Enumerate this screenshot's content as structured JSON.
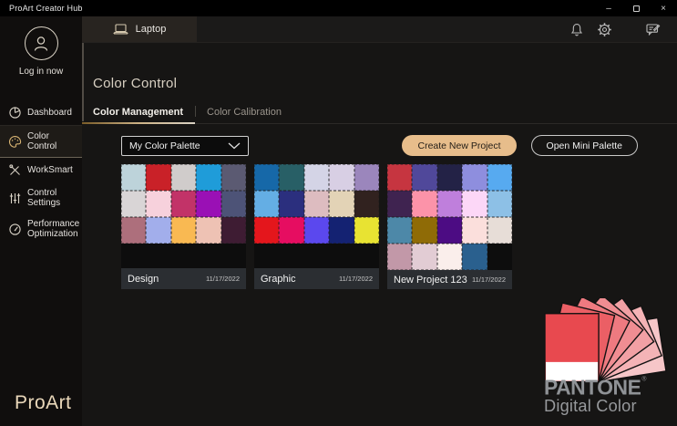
{
  "window": {
    "title": "ProArt Creator Hub",
    "minimize": "–",
    "close": "×"
  },
  "topbar": {
    "device_tab": "Laptop"
  },
  "sidebar": {
    "login_label": "Log in now",
    "items": [
      {
        "label": "Dashboard",
        "active": false
      },
      {
        "label": "Color Control",
        "active": true
      },
      {
        "label": "WorkSmart",
        "active": false
      },
      {
        "label": "Control Settings",
        "active": false
      },
      {
        "label": "Performance Optimization",
        "active": false
      }
    ]
  },
  "main": {
    "title": "Color Control",
    "tabs": [
      {
        "label": "Color Management",
        "active": true
      },
      {
        "label": "Color Calibration",
        "active": false
      }
    ],
    "palette_dropdown": {
      "value": "My Color Palette"
    },
    "buttons": {
      "create": "Create New Project",
      "mini": "Open Mini Palette"
    },
    "projects": [
      {
        "name": "Design",
        "date": "11/17/2022",
        "colors": [
          "#bdd3da",
          "#c92128",
          "#d0cccb",
          "#1f9cd9",
          "#5b5a72",
          "#d9d5d6",
          "#f7d1dc",
          "#c23368",
          "#9a10b5",
          "#4d5377",
          "#ad6f7c",
          "#a2aeeb",
          "#f9b952",
          "#eec2b4",
          "#3e1c33"
        ]
      },
      {
        "name": "Graphic",
        "date": "11/17/2022",
        "colors": [
          "#1668a8",
          "#285f66",
          "#d4d4e6",
          "#d8cfe4",
          "#9b86bc",
          "#64aee4",
          "#2b2f7e",
          "#ddbcc0",
          "#e3d3b6",
          "#31221f",
          "#e4161c",
          "#e60d61",
          "#5b48ee",
          "#142272",
          "#e8e332"
        ]
      },
      {
        "name": "New Project 123",
        "date": "11/17/2022",
        "colors": [
          "#c63540",
          "#50489a",
          "#232246",
          "#8e8ede",
          "#57aaf0",
          "#3f2350",
          "#fc93a9",
          "#bf7fdc",
          "#fcd7f7",
          "#8dc0e6",
          "#4d88a8",
          "#8f6b06",
          "#4c0c83",
          "#fbdfdc",
          "#e7ddd7",
          "#c298a8",
          "#e2ccd4",
          "#faeeeb",
          "#2a608e"
        ]
      }
    ]
  },
  "branding": {
    "proart": "ProArt",
    "pantone": {
      "name": "PANTONE",
      "reg": "®",
      "subtitle": "Digital Color",
      "fan_colors": [
        "#f6c6c8",
        "#f4b3b6",
        "#f2a0a4",
        "#f08d92",
        "#ee7a80",
        "#eb5f65",
        "#e8494f"
      ],
      "front_bottom": "#ffffff",
      "text_color": "#8f9296"
    }
  },
  "colors": {
    "accent": "#e7bd8b",
    "active_underline_gold": "#cdb286"
  }
}
